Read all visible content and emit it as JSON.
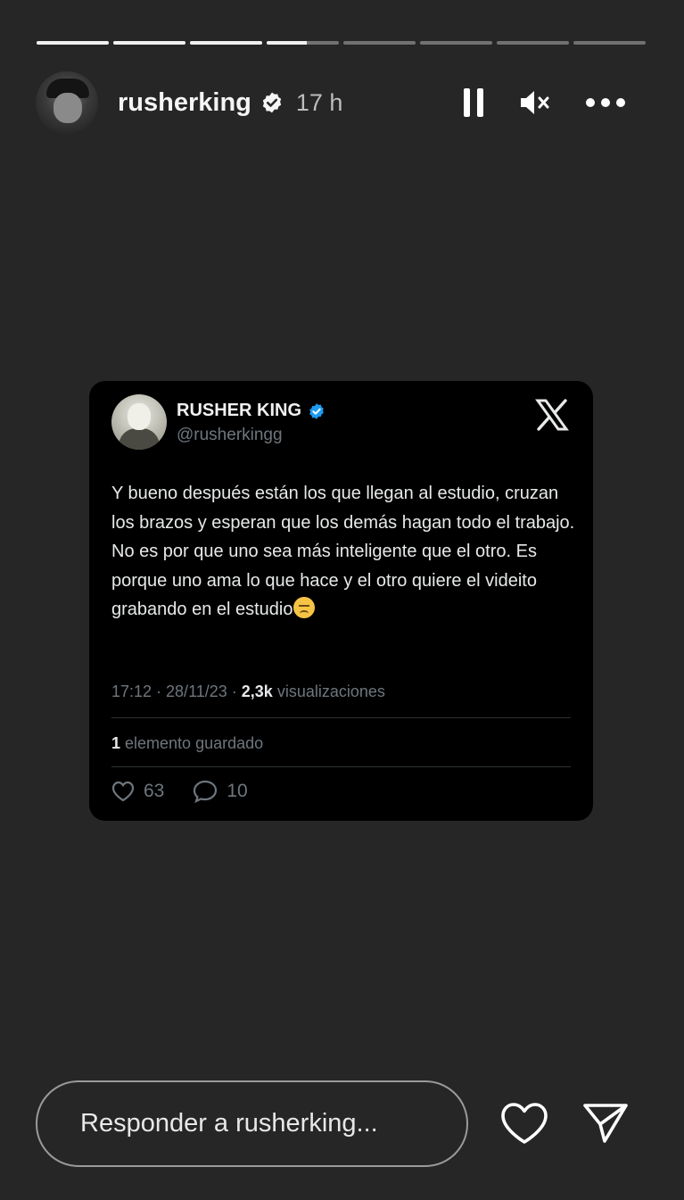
{
  "progress": {
    "segments": 8,
    "current_index": 3,
    "current_fill": 0.55
  },
  "header": {
    "username": "rusherking",
    "time": "17 h",
    "icons": [
      "verified-icon",
      "pause-icon",
      "mute-icon",
      "more-icon"
    ]
  },
  "tweet": {
    "display_name": "RUSHER KING",
    "handle": "@rusherkingg",
    "text": "Y bueno después están los que llegan al estudio, cruzan los brazos y esperan que los demás hagan todo el trabajo. No es por que uno sea más inteligente que el otro. Es porque uno ama lo que hace y el otro quiere el videito grabando en el estudio",
    "timestamp": "17:12 · 28/11/23 · ",
    "views_count": "2,3k",
    "views_label": " visualizaciones",
    "saved_count": "1",
    "saved_label": " elemento guardado",
    "likes": "63",
    "replies": "10"
  },
  "reply": {
    "placeholder": "Responder a rusherking..."
  },
  "colors": {
    "background": "#262626",
    "card": "#000000",
    "verified": "#1d9bf0",
    "muted_text": "#6e767d"
  }
}
